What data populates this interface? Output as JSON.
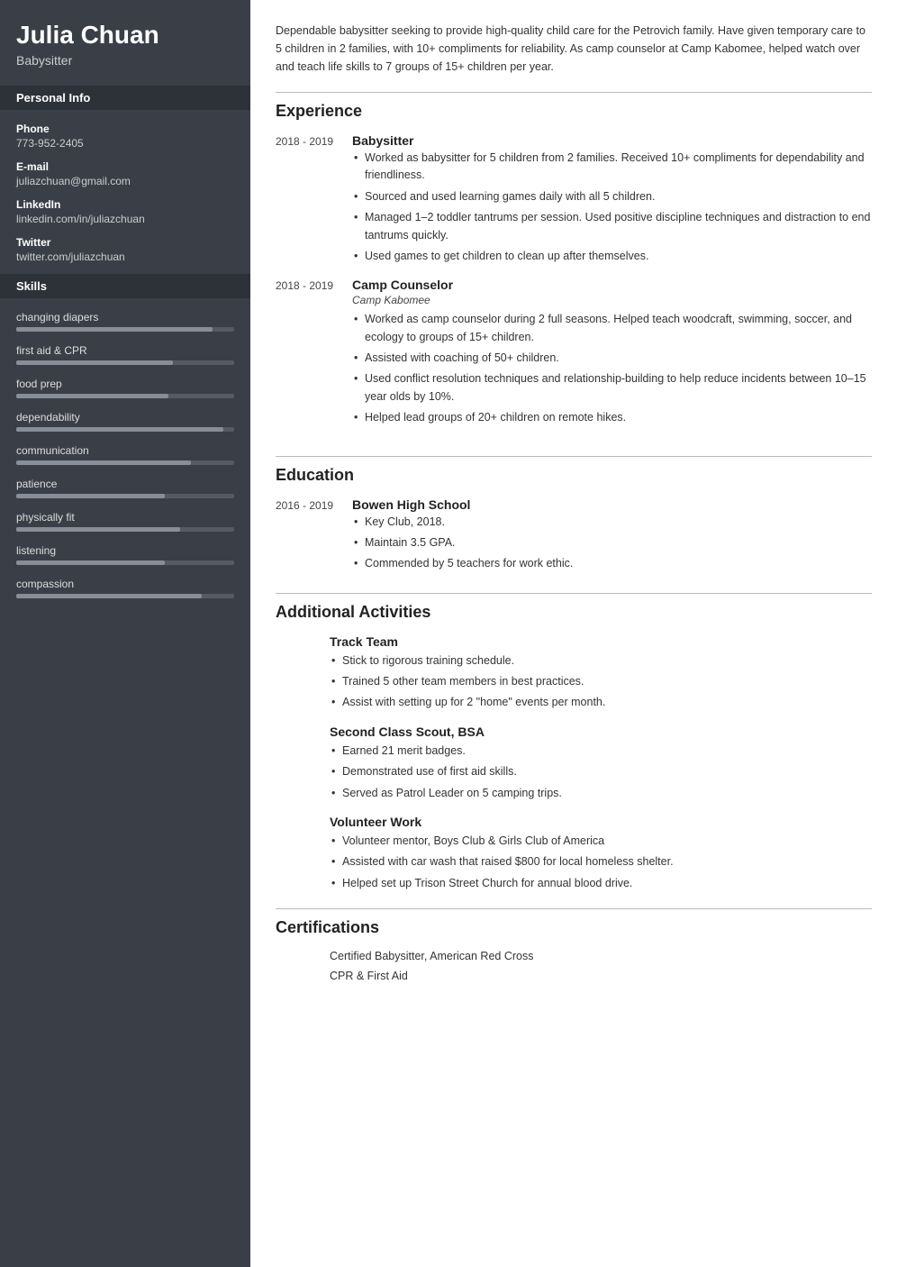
{
  "sidebar": {
    "name": "Julia Chuan",
    "title": "Babysitter",
    "sections": {
      "personal_info_label": "Personal Info",
      "phone_label": "Phone",
      "phone_value": "773-952-2405",
      "email_label": "E-mail",
      "email_value": "juliazchuan@gmail.com",
      "linkedin_label": "LinkedIn",
      "linkedin_value": "linkedin.com/in/juliazchuan",
      "twitter_label": "Twitter",
      "twitter_value": "twitter.com/juliazchuan",
      "skills_label": "Skills"
    },
    "skills": [
      {
        "name": "changing diapers",
        "fill_pct": 90
      },
      {
        "name": "first aid & CPR",
        "fill_pct": 72
      },
      {
        "name": "food prep",
        "fill_pct": 70
      },
      {
        "name": "dependability",
        "fill_pct": 95
      },
      {
        "name": "communication",
        "fill_pct": 80
      },
      {
        "name": "patience",
        "fill_pct": 68
      },
      {
        "name": "physically fit",
        "fill_pct": 75
      },
      {
        "name": "listening",
        "fill_pct": 68
      },
      {
        "name": "compassion",
        "fill_pct": 85
      }
    ]
  },
  "main": {
    "summary": "Dependable babysitter seeking to provide high-quality child care for the Petrovich family. Have given temporary care to 5 children in 2 families, with 10+ compliments for reliability. As camp counselor at Camp Kabomee, helped watch over and teach life skills to 7 groups of 15+ children per year.",
    "experience_heading": "Experience",
    "jobs": [
      {
        "dates": "2018 - 2019",
        "title": "Babysitter",
        "company": "",
        "bullets": [
          "Worked as babysitter for 5 children from 2 families. Received 10+ compliments for dependability and friendliness.",
          "Sourced and used learning games daily with all 5 children.",
          "Managed 1–2 toddler tantrums per session. Used positive discipline techniques and distraction to end tantrums quickly.",
          "Used games to get children to clean up after themselves."
        ]
      },
      {
        "dates": "2018 - 2019",
        "title": "Camp Counselor",
        "company": "Camp Kabomee",
        "bullets": [
          "Worked as camp counselor during 2 full seasons. Helped teach woodcraft, swimming, soccer, and ecology to groups of 15+ children.",
          "Assisted with coaching of 50+ children.",
          "Used conflict resolution techniques and relationship-building to help reduce incidents between 10–15 year olds by 10%.",
          "Helped lead groups of 20+ children on remote hikes."
        ]
      }
    ],
    "education_heading": "Education",
    "schools": [
      {
        "dates": "2016 - 2019",
        "name": "Bowen High School",
        "bullets": [
          "Key Club, 2018.",
          "Maintain 3.5 GPA.",
          "Commended by 5 teachers for work ethic."
        ]
      }
    ],
    "additional_activities_heading": "Additional Activities",
    "activities": [
      {
        "title": "Track Team",
        "bullets": [
          "Stick to rigorous training schedule.",
          "Trained 5 other team members in best practices.",
          "Assist with setting up for 2 \"home\" events per month."
        ]
      },
      {
        "title": "Second Class Scout, BSA",
        "bullets": [
          "Earned 21 merit badges.",
          "Demonstrated use of first aid skills.",
          "Served as Patrol Leader on 5 camping trips."
        ]
      },
      {
        "title": "Volunteer Work",
        "bullets": [
          "Volunteer mentor, Boys Club & Girls Club of America",
          "Assisted with car wash that raised $800 for local homeless shelter.",
          "Helped set up Trison Street Church for annual blood drive."
        ]
      }
    ],
    "certifications_heading": "Certifications",
    "certifications": [
      "Certified Babysitter, American Red Cross",
      "CPR & First Aid"
    ]
  }
}
